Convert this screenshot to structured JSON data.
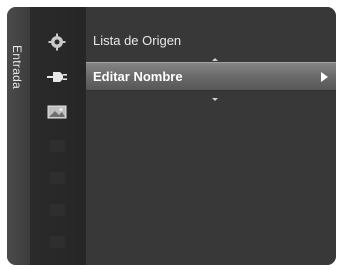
{
  "sidebar": {
    "tab_label": "Entrada"
  },
  "icons": [
    {
      "name": "gear-icon"
    },
    {
      "name": "plug-icon",
      "selected": true
    },
    {
      "name": "picture-icon"
    },
    {
      "name": "placeholder-icon"
    },
    {
      "name": "placeholder-icon"
    },
    {
      "name": "placeholder-icon"
    },
    {
      "name": "placeholder-icon"
    }
  ],
  "menu": {
    "items": [
      {
        "label": "Lista de Origen"
      },
      {
        "label": "Editar Nombre",
        "active": true
      }
    ]
  },
  "colors": {
    "highlight": "#6c6c6c",
    "panel": "#383838",
    "icon_column": "#262626"
  }
}
